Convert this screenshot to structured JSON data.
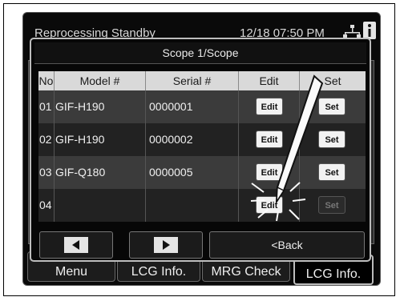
{
  "status_bar": {
    "title": "Reprocessing Standby",
    "datetime": "12/18 07:50 PM",
    "network_icon": "network-icon",
    "info_icon": "info-icon"
  },
  "bottom_tabs": [
    {
      "label": "Menu"
    },
    {
      "label": "LCG Info."
    },
    {
      "label": "MRG Check"
    },
    {
      "label": "LCG Info."
    }
  ],
  "dialog": {
    "title": "Scope 1/Scope",
    "columns": [
      "No",
      "Model #",
      "Serial #",
      "Edit",
      "Set"
    ],
    "rows": [
      {
        "no": "01",
        "model": "GIF-H190",
        "serial": "0000001",
        "edit": "Edit",
        "set": "Set",
        "set_enabled": true
      },
      {
        "no": "02",
        "model": "GIF-H190",
        "serial": "0000002",
        "edit": "Edit",
        "set": "Set",
        "set_enabled": true
      },
      {
        "no": "03",
        "model": "GIF-Q180",
        "serial": "0000005",
        "edit": "Edit",
        "set": "Set",
        "set_enabled": true
      },
      {
        "no": "04",
        "model": "",
        "serial": "",
        "edit": "Edit",
        "set": "Set",
        "set_enabled": false
      }
    ],
    "nav": {
      "prev_icon": "left-arrow-icon",
      "next_icon": "right-arrow-icon",
      "back_label": "<Back"
    }
  },
  "colors": {
    "screen_bg": "#0a0a0a",
    "header_bg": "#d9d9d9",
    "button_bg": "#f2f2f2"
  }
}
